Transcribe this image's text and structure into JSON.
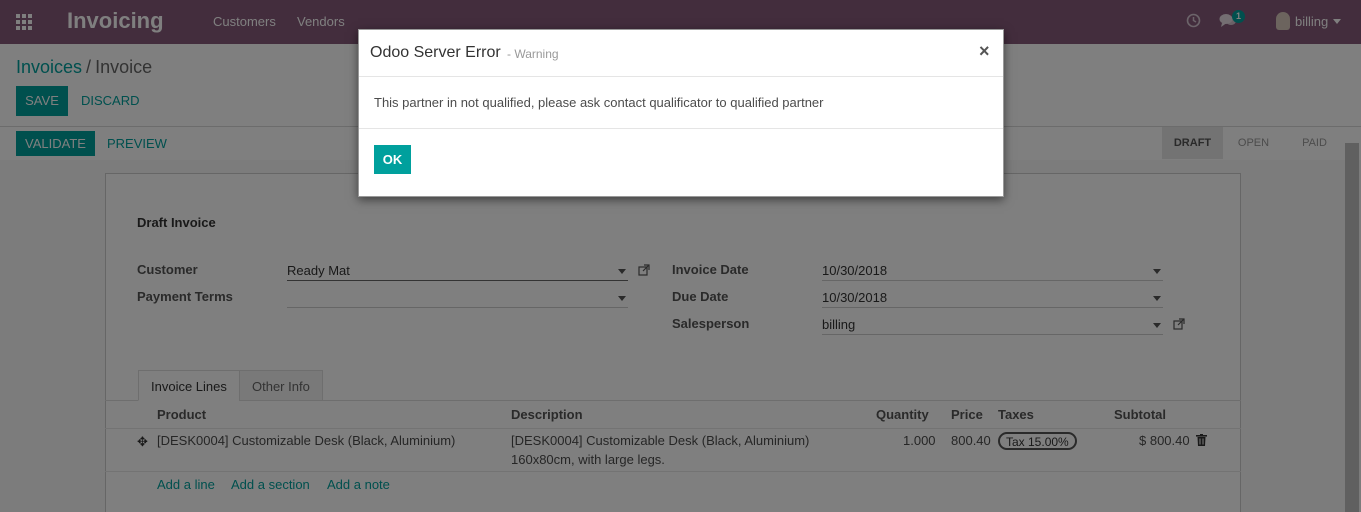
{
  "navbar": {
    "brand": "Invoicing",
    "menu": [
      "Customers",
      "Vendors"
    ],
    "messages_count": "1",
    "user": "billing"
  },
  "breadcrumb": {
    "parent": "Invoices",
    "separator": "/",
    "current": "Invoice"
  },
  "buttons": {
    "save": "SAVE",
    "discard": "DISCARD",
    "validate": "VALIDATE",
    "preview": "PREVIEW"
  },
  "statusbar": {
    "states": [
      "DRAFT",
      "OPEN",
      "PAID"
    ],
    "active": "DRAFT"
  },
  "form": {
    "title": "Draft Invoice",
    "customer_label": "Customer",
    "customer_value": "Ready Mat",
    "payment_terms_label": "Payment Terms",
    "payment_terms_value": "",
    "invoice_date_label": "Invoice Date",
    "invoice_date_value": "10/30/2018",
    "due_date_label": "Due Date",
    "due_date_value": "10/30/2018",
    "salesperson_label": "Salesperson",
    "salesperson_value": "billing"
  },
  "tabs": [
    "Invoice Lines",
    "Other Info"
  ],
  "table": {
    "headers": {
      "product": "Product",
      "description": "Description",
      "quantity": "Quantity",
      "price": "Price",
      "taxes": "Taxes",
      "subtotal": "Subtotal"
    },
    "rows": [
      {
        "product": "[DESK0004] Customizable Desk (Black, Aluminium)",
        "description_line1": "[DESK0004] Customizable Desk (Black, Aluminium)",
        "description_line2": "160x80cm, with large legs.",
        "quantity": "1.000",
        "price": "800.40",
        "tax": "Tax 15.00%",
        "subtotal": "$ 800.40"
      }
    ],
    "add_links": [
      "Add a line",
      "Add a section",
      "Add a note"
    ]
  },
  "modal": {
    "title": "Odoo Server Error",
    "subtitle": "- Warning",
    "close": "×",
    "message": "This partner in not qualified, please ask contact qualificator to qualified partner",
    "ok": "OK"
  },
  "colors": {
    "navbar": "#875a7b",
    "accent": "#00a09d"
  }
}
